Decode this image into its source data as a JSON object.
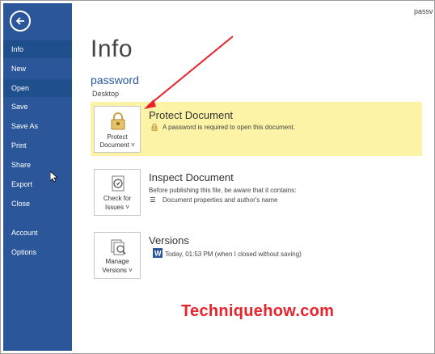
{
  "window": {
    "title_fragment": "passv"
  },
  "sidebar": {
    "items": [
      {
        "label": "Info"
      },
      {
        "label": "New"
      },
      {
        "label": "Open"
      },
      {
        "label": "Save"
      },
      {
        "label": "Save As"
      },
      {
        "label": "Print"
      },
      {
        "label": "Share"
      },
      {
        "label": "Export"
      },
      {
        "label": "Close"
      },
      {
        "label": "Account"
      },
      {
        "label": "Options"
      }
    ]
  },
  "main": {
    "title": "Info",
    "document": {
      "name": "password",
      "location": "Desktop"
    },
    "protect": {
      "tile_line1": "Protect",
      "tile_line2": "Document",
      "dropdown": "˅",
      "heading": "Protect Document",
      "text": "A password is required to open this document."
    },
    "inspect": {
      "tile_line1": "Check for",
      "tile_line2": "Issues",
      "heading": "Inspect Document",
      "text": "Before publishing this file, be aware that it contains:",
      "bullet": "Document properties and author's name"
    },
    "versions": {
      "tile_line1": "Manage",
      "tile_line2": "Versions",
      "heading": "Versions",
      "entry": "Today, 01:53 PM (when I closed without saving)"
    }
  },
  "watermark": "Techniquehow.com",
  "colors": {
    "sidebar": "#2b579a",
    "protect_band": "#fcf3a6",
    "arrow": "#e8232b"
  }
}
